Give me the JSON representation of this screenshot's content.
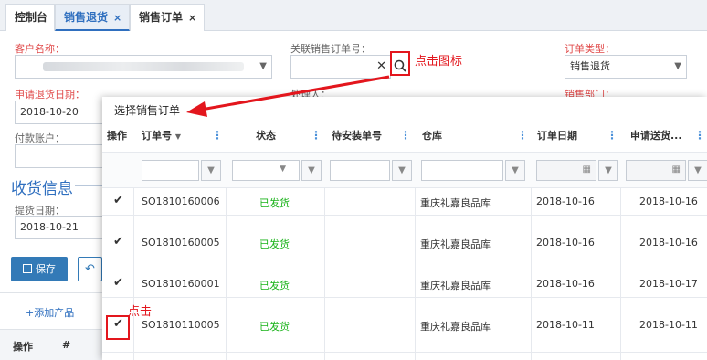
{
  "tabs": [
    {
      "label": "控制台",
      "closable": false,
      "active": false
    },
    {
      "label": "销售退货",
      "closable": true,
      "active": true
    },
    {
      "label": "销售订单",
      "closable": true,
      "active": false
    }
  ],
  "tab_close_glyph": "×",
  "form": {
    "customer_label": "客户名称：",
    "related_order_label": "关联销售订单号：",
    "order_type_label": "订单类型：",
    "order_type_value": "销售退货",
    "return_date_label": "申请退货日期：",
    "return_date_value": "2018-10-20",
    "handler_label": "处理人：",
    "sales_dept_label": "销售部门：",
    "payer_label": "付款账户："
  },
  "receiving": {
    "section_title": "收货信息",
    "pickup_date_label": "提货日期：",
    "pickup_date_value": "2018-10-21"
  },
  "buttons": {
    "save_label": "保存",
    "undo_icon": "undo-icon"
  },
  "bottom": {
    "add_product_label": "+添加产品",
    "col_action": "操作",
    "col_index": "#"
  },
  "annotations": {
    "search_hint": "点击图标",
    "click_hint": "点击",
    "color": "#e3161d"
  },
  "modal": {
    "title": "选择销售订单",
    "columns": [
      "操作",
      "订单号",
      "状态",
      "待安装单号",
      "仓库",
      "订单日期",
      "申请送货..."
    ],
    "sort_glyph": "▼",
    "rows": [
      {
        "order_no": "SO1810160006",
        "status": "已发货",
        "install_no": "",
        "warehouse": "重庆礼嘉良品库",
        "order_date": "2018-10-16",
        "delivery_date": "2018-10-16"
      },
      {
        "order_no": "SO1810160005",
        "status": "已发货",
        "install_no": "",
        "warehouse": "重庆礼嘉良品库",
        "order_date": "2018-10-16",
        "delivery_date": "2018-10-16"
      },
      {
        "order_no": "SO1810160001",
        "status": "已发货",
        "install_no": "",
        "warehouse": "重庆礼嘉良品库",
        "order_date": "2018-10-16",
        "delivery_date": "2018-10-17"
      },
      {
        "order_no": "SO1810110005",
        "status": "已发货",
        "install_no": "",
        "warehouse": "重庆礼嘉良品库",
        "order_date": "2018-10-11",
        "delivery_date": "2018-10-11"
      }
    ]
  },
  "colors": {
    "accent": "#2f6fbf",
    "primary_button": "#337ab7",
    "status_green": "#19b319",
    "required_red": "#e04a4a"
  }
}
